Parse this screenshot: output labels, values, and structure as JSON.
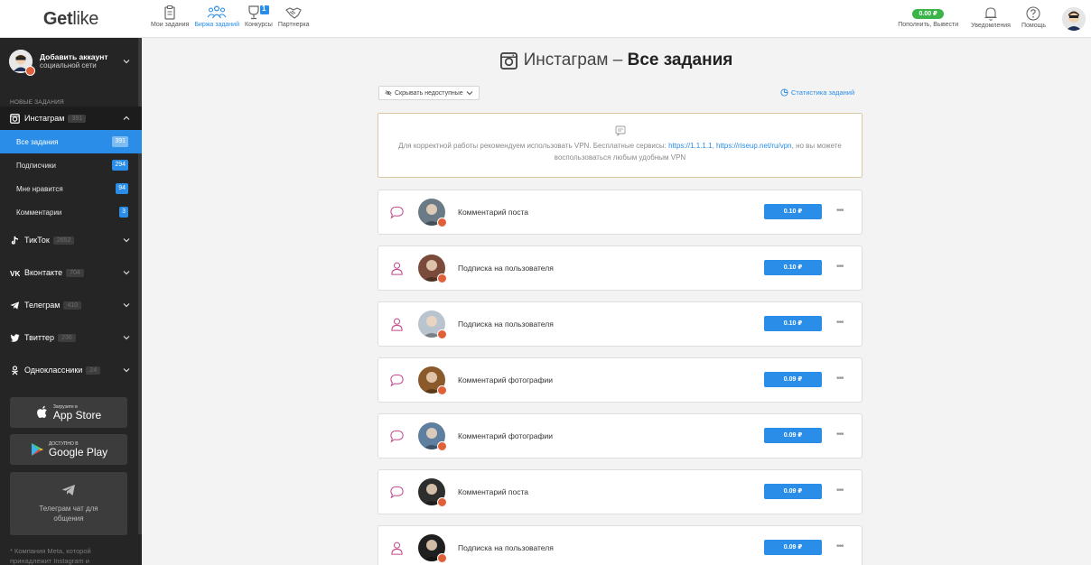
{
  "logo": {
    "bold": "Get",
    "light": "like"
  },
  "nav": [
    {
      "label": "Мои задания",
      "icon": "clipboard-icon",
      "active": false
    },
    {
      "label": "Биржа заданий",
      "icon": "users-icon",
      "active": true
    },
    {
      "label": "Конкурсы",
      "icon": "trophy-icon",
      "active": false,
      "badge": "1"
    },
    {
      "label": "Партнерка",
      "icon": "handshake-icon",
      "active": false
    }
  ],
  "right_nav": {
    "balance": "0.00 ₽",
    "balance_label": "Пополнить, Вывести",
    "notifications_label": "Уведомления",
    "help_label": "Помощь"
  },
  "sidebar": {
    "account": {
      "title": "Добавить аккаунт",
      "subtitle": "социальной сети"
    },
    "section_label": "НОВЫЕ ЗАДАНИЯ",
    "instagram": {
      "name": "Инстаграм",
      "count": "391"
    },
    "instagram_items": [
      {
        "label": "Все задания",
        "count": "391",
        "active": true
      },
      {
        "label": "Подписчики",
        "count": "294",
        "active": false
      },
      {
        "label": "Мне нравится",
        "count": "94",
        "active": false
      },
      {
        "label": "Комментарии",
        "count": "3",
        "active": false
      }
    ],
    "networks": [
      {
        "name": "ТикТок",
        "count": "2652",
        "icon": "tiktok-icon"
      },
      {
        "name": "Вконтакте",
        "count": "704",
        "icon": "vk-icon"
      },
      {
        "name": "Телеграм",
        "count": "410",
        "icon": "telegram-icon"
      },
      {
        "name": "Твиттер",
        "count": "236",
        "icon": "twitter-icon"
      },
      {
        "name": "Одноклассники",
        "count": "24",
        "icon": "ok-icon"
      }
    ],
    "app_store": {
      "small": "Загрузите в",
      "big": "App Store"
    },
    "google_play": {
      "small": "ДОСТУПНО В",
      "big": "Google Play"
    },
    "telegram_chat": "Телеграм чат для общения",
    "meta_note": "* Компания Meta, которой принадлежит Instagram и"
  },
  "main": {
    "title_light": "Инстаграм –",
    "title_bold": "Все задания",
    "filter_label": "Скрывать недоступные",
    "stats_label": "Статистика заданий",
    "notice": {
      "text_before": "Для корректной работы рекомендуем использовать VPN. Бесплатные сервисы: ",
      "link1": "https://1.1.1.1",
      "sep": ", ",
      "link2": "https://riseup.net/ru/vpn",
      "text_after": ", но вы можете воспользоваться любым удобным VPN"
    },
    "tasks": [
      {
        "type": "comment",
        "label": "Комментарий поста",
        "price": "0.10 ₽",
        "avatar_color": "#6a7a86"
      },
      {
        "type": "follow",
        "label": "Подписка на пользователя",
        "price": "0.10 ₽",
        "avatar_color": "#7a4a3a"
      },
      {
        "type": "follow",
        "label": "Подписка на пользователя",
        "price": "0.10 ₽",
        "avatar_color": "#b9c4cf"
      },
      {
        "type": "comment",
        "label": "Комментарий фотографии",
        "price": "0.09 ₽",
        "avatar_color": "#8a5a2a"
      },
      {
        "type": "comment",
        "label": "Комментарий фотографии",
        "price": "0.09 ₽",
        "avatar_color": "#5f7fa0"
      },
      {
        "type": "comment",
        "label": "Комментарий поста",
        "price": "0.09 ₽",
        "avatar_color": "#2e2e2e"
      },
      {
        "type": "follow",
        "label": "Подписка на пользователя",
        "price": "0.09 ₽",
        "avatar_color": "#1f1f1f"
      }
    ]
  },
  "colors": {
    "accent": "#2a8ee8",
    "success": "#3bb54a",
    "sidebar": "#252525",
    "badge": "#e0603a"
  }
}
